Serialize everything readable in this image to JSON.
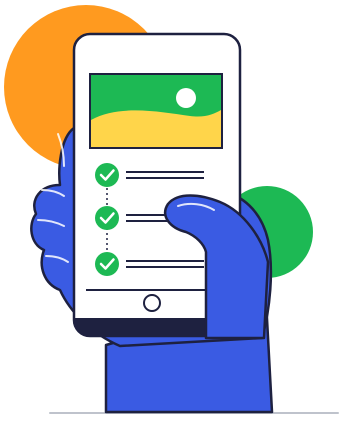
{
  "illustration": {
    "checklist": [
      {
        "checked": true
      },
      {
        "checked": true
      },
      {
        "checked": true
      }
    ]
  },
  "colors": {
    "orange": "#FF9A1F",
    "green": "#1DB954",
    "yellow": "#FFD54A",
    "blue": "#3A5BE3",
    "ink": "#1E2140",
    "screen": "#FFFFFF",
    "ground": "#BFC3CC"
  }
}
